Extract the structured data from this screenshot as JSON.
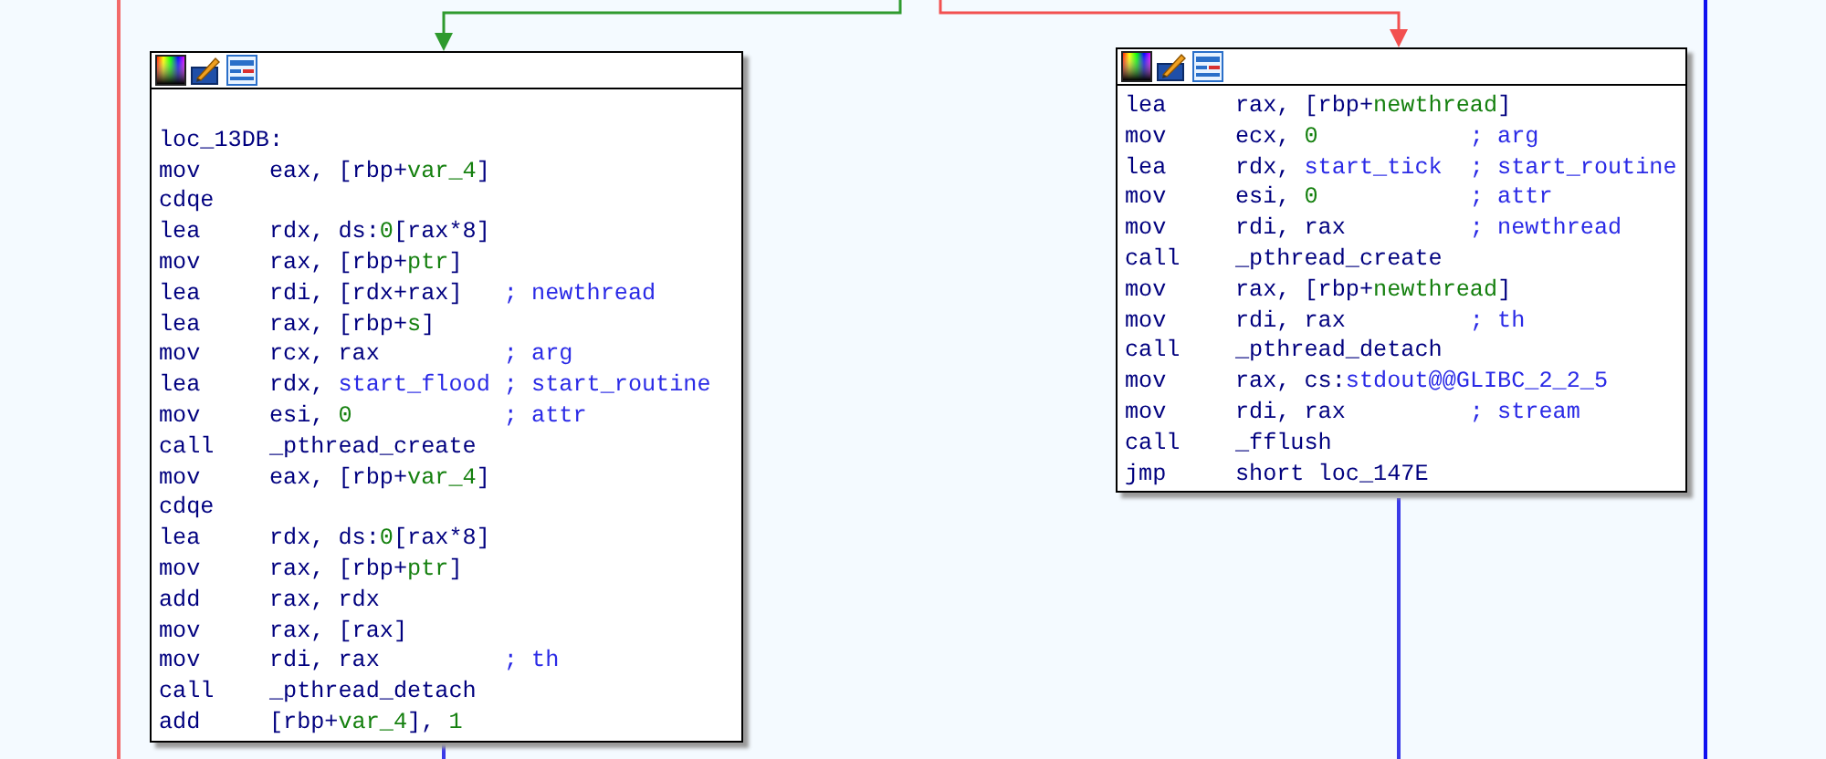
{
  "edges": [
    {
      "kind": "arrow",
      "color": "#2e9a2e"
    },
    {
      "kind": "arrow",
      "color": "#f25050"
    },
    {
      "kind": "line",
      "color": "#f26a6a"
    },
    {
      "kind": "line",
      "color": "#1010f0"
    },
    {
      "kind": "line",
      "color": "#3a3ae8"
    },
    {
      "kind": "line",
      "color": "#3a3ae8"
    }
  ],
  "nodes": [
    {
      "lines": [
        {
          "kind": "label",
          "text": "loc_13DB:"
        },
        {
          "kind": "insn",
          "mnemonic": "mov",
          "operands": [
            {
              "kind": "reg",
              "text": "eax, [rbp+"
            },
            {
              "kind": "var",
              "text": "var_4"
            },
            {
              "kind": "reg",
              "text": "]"
            }
          ]
        },
        {
          "kind": "insn",
          "mnemonic": "cdqe"
        },
        {
          "kind": "insn",
          "mnemonic": "lea",
          "operands": [
            {
              "kind": "reg",
              "text": "rdx, ds:"
            },
            {
              "kind": "var",
              "text": "0"
            },
            {
              "kind": "reg",
              "text": "[rax*8]"
            }
          ]
        },
        {
          "kind": "insn",
          "mnemonic": "mov",
          "operands": [
            {
              "kind": "reg",
              "text": "rax, [rbp+"
            },
            {
              "kind": "var",
              "text": "ptr"
            },
            {
              "kind": "reg",
              "text": "]"
            }
          ]
        },
        {
          "kind": "insn",
          "mnemonic": "lea",
          "operands": [
            {
              "kind": "reg",
              "text": "rdi, [rdx+rax]"
            }
          ],
          "comment": "; newthread"
        },
        {
          "kind": "insn",
          "mnemonic": "lea",
          "operands": [
            {
              "kind": "reg",
              "text": "rax, [rbp+"
            },
            {
              "kind": "var",
              "text": "s"
            },
            {
              "kind": "reg",
              "text": "]"
            }
          ]
        },
        {
          "kind": "insn",
          "mnemonic": "mov",
          "operands": [
            {
              "kind": "reg",
              "text": "rcx, rax"
            }
          ],
          "comment": "; arg"
        },
        {
          "kind": "insn",
          "mnemonic": "lea",
          "operands": [
            {
              "kind": "reg",
              "text": "rdx, "
            },
            {
              "kind": "name",
              "text": "start_flood"
            }
          ],
          "comment": "; start_routine"
        },
        {
          "kind": "insn",
          "mnemonic": "mov",
          "operands": [
            {
              "kind": "reg",
              "text": "esi, "
            },
            {
              "kind": "var",
              "text": "0"
            }
          ],
          "comment": "; attr"
        },
        {
          "kind": "insn",
          "mnemonic": "call",
          "operands": [
            {
              "kind": "reg",
              "text": "_pthread_create"
            }
          ]
        },
        {
          "kind": "insn",
          "mnemonic": "mov",
          "operands": [
            {
              "kind": "reg",
              "text": "eax, [rbp+"
            },
            {
              "kind": "var",
              "text": "var_4"
            },
            {
              "kind": "reg",
              "text": "]"
            }
          ]
        },
        {
          "kind": "insn",
          "mnemonic": "cdqe"
        },
        {
          "kind": "insn",
          "mnemonic": "lea",
          "operands": [
            {
              "kind": "reg",
              "text": "rdx, ds:"
            },
            {
              "kind": "var",
              "text": "0"
            },
            {
              "kind": "reg",
              "text": "[rax*8]"
            }
          ]
        },
        {
          "kind": "insn",
          "mnemonic": "mov",
          "operands": [
            {
              "kind": "reg",
              "text": "rax, [rbp+"
            },
            {
              "kind": "var",
              "text": "ptr"
            },
            {
              "kind": "reg",
              "text": "]"
            }
          ]
        },
        {
          "kind": "insn",
          "mnemonic": "add",
          "operands": [
            {
              "kind": "reg",
              "text": "rax, rdx"
            }
          ]
        },
        {
          "kind": "insn",
          "mnemonic": "mov",
          "operands": [
            {
              "kind": "reg",
              "text": "rax, [rax]"
            }
          ]
        },
        {
          "kind": "insn",
          "mnemonic": "mov",
          "operands": [
            {
              "kind": "reg",
              "text": "rdi, rax"
            }
          ],
          "comment": "; th"
        },
        {
          "kind": "insn",
          "mnemonic": "call",
          "operands": [
            {
              "kind": "reg",
              "text": "_pthread_detach"
            }
          ]
        },
        {
          "kind": "insn",
          "mnemonic": "add",
          "operands": [
            {
              "kind": "reg",
              "text": "[rbp+"
            },
            {
              "kind": "var",
              "text": "var_4"
            },
            {
              "kind": "reg",
              "text": "], "
            },
            {
              "kind": "var",
              "text": "1"
            }
          ]
        }
      ]
    },
    {
      "lines": [
        {
          "kind": "insn",
          "mnemonic": "lea",
          "operands": [
            {
              "kind": "reg",
              "text": "rax, [rbp+"
            },
            {
              "kind": "var",
              "text": "newthread"
            },
            {
              "kind": "reg",
              "text": "]"
            }
          ]
        },
        {
          "kind": "insn",
          "mnemonic": "mov",
          "operands": [
            {
              "kind": "reg",
              "text": "ecx, "
            },
            {
              "kind": "var",
              "text": "0"
            }
          ],
          "comment": "; arg"
        },
        {
          "kind": "insn",
          "mnemonic": "lea",
          "operands": [
            {
              "kind": "reg",
              "text": "rdx, "
            },
            {
              "kind": "name",
              "text": "start_tick"
            }
          ],
          "comment": "; start_routine"
        },
        {
          "kind": "insn",
          "mnemonic": "mov",
          "operands": [
            {
              "kind": "reg",
              "text": "esi, "
            },
            {
              "kind": "var",
              "text": "0"
            }
          ],
          "comment": "; attr"
        },
        {
          "kind": "insn",
          "mnemonic": "mov",
          "operands": [
            {
              "kind": "reg",
              "text": "rdi, rax"
            }
          ],
          "comment": "; newthread"
        },
        {
          "kind": "insn",
          "mnemonic": "call",
          "operands": [
            {
              "kind": "reg",
              "text": "_pthread_create"
            }
          ]
        },
        {
          "kind": "insn",
          "mnemonic": "mov",
          "operands": [
            {
              "kind": "reg",
              "text": "rax, [rbp+"
            },
            {
              "kind": "var",
              "text": "newthread"
            },
            {
              "kind": "reg",
              "text": "]"
            }
          ]
        },
        {
          "kind": "insn",
          "mnemonic": "mov",
          "operands": [
            {
              "kind": "reg",
              "text": "rdi, rax"
            }
          ],
          "comment": "; th"
        },
        {
          "kind": "insn",
          "mnemonic": "call",
          "operands": [
            {
              "kind": "reg",
              "text": "_pthread_detach"
            }
          ]
        },
        {
          "kind": "insn",
          "mnemonic": "mov",
          "operands": [
            {
              "kind": "reg",
              "text": "rax, cs:"
            },
            {
              "kind": "name",
              "text": "stdout@@GLIBC_2_2_5"
            }
          ]
        },
        {
          "kind": "insn",
          "mnemonic": "mov",
          "operands": [
            {
              "kind": "reg",
              "text": "rdi, rax"
            }
          ],
          "comment": "; stream"
        },
        {
          "kind": "insn",
          "mnemonic": "call",
          "operands": [
            {
              "kind": "reg",
              "text": "_fflush"
            }
          ]
        },
        {
          "kind": "insn",
          "mnemonic": "jmp",
          "operands": [
            {
              "kind": "reg",
              "text": "short loc_147E"
            }
          ]
        }
      ]
    }
  ]
}
